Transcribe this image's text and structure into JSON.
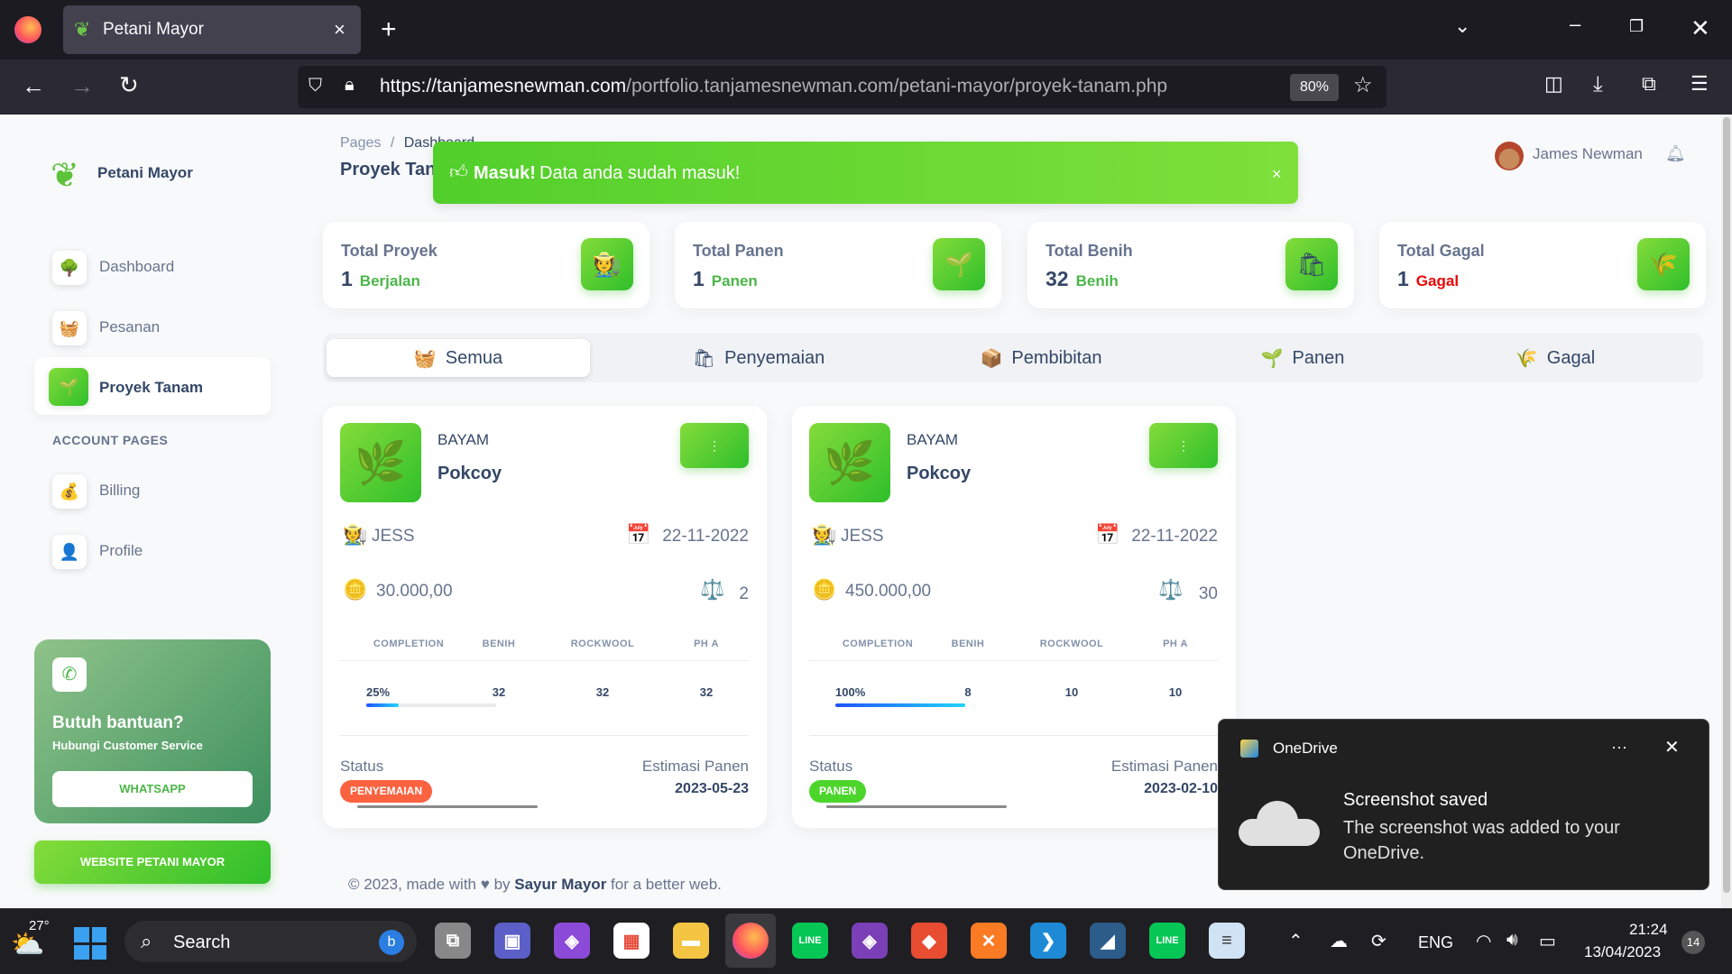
{
  "browser": {
    "tab_title": "Petani Mayor",
    "url_host": "https://tanjamesnewman.com",
    "url_path": "/portfolio.tanjamesnewman.com/petani-mayor/proyek-tanam.php",
    "zoom": "80%"
  },
  "sidebar": {
    "brand": "Petani Mayor",
    "items": [
      {
        "label": "Dashboard",
        "icon": "🌳"
      },
      {
        "label": "Pesanan",
        "icon": "🧺"
      },
      {
        "label": "Proyek Tanam",
        "icon": "🌱"
      }
    ],
    "section_label": "ACCOUNT PAGES",
    "account_items": [
      {
        "label": "Billing",
        "icon": "💰"
      },
      {
        "label": "Profile",
        "icon": "👤"
      }
    ],
    "help": {
      "title": "Butuh bantuan?",
      "subtitle": "Hubungi Customer Service",
      "button": "WHATSAPP"
    },
    "website_button": "WEBSITE PETANI MAYOR"
  },
  "header": {
    "breadcrumb_root": "Pages",
    "breadcrumb_sep": "/",
    "breadcrumb_current": "Dashboard",
    "page_title": "Proyek Tanam",
    "user_name": "James Newman"
  },
  "alert": {
    "strong": "Masuk!",
    "message": "Data anda sudah masuk!",
    "close": "×"
  },
  "stats": [
    {
      "title": "Total Proyek",
      "value": "1",
      "unit": "Berjalan",
      "unit_color": "#4cb648",
      "icon": "🧑‍🌾"
    },
    {
      "title": "Total Panen",
      "value": "1",
      "unit": "Panen",
      "unit_color": "#4cb648",
      "icon": "🌱"
    },
    {
      "title": "Total Benih",
      "value": "32",
      "unit": "Benih",
      "unit_color": "#4cb648",
      "icon": "🛍"
    },
    {
      "title": "Total Gagal",
      "value": "1",
      "unit": "Gagal",
      "unit_color": "#ea0606",
      "icon": "🌾"
    }
  ],
  "filter_tabs": [
    {
      "label": "Semua",
      "icon": "🧺"
    },
    {
      "label": "Penyemaian",
      "icon": "🛍"
    },
    {
      "label": "Pembibitan",
      "icon": "📦"
    },
    {
      "label": "Panen",
      "icon": "🌱"
    },
    {
      "label": "Gagal",
      "icon": "🌾"
    }
  ],
  "table_headers": [
    "COMPLETION",
    "BENIH",
    "ROCKWOOL",
    "PH A"
  ],
  "labels": {
    "status": "Status",
    "estimasi": "Estimasi Panen"
  },
  "projects": [
    {
      "category": "BAYAM",
      "name": "Pokcoy",
      "farmer": "JESS",
      "date": "22-11-2022",
      "price": "30.000,00",
      "quantity": "2",
      "completion": "25%",
      "completion_value": 25,
      "benih": "32",
      "rockwool": "32",
      "ph": "32",
      "status": "PENYEMAIAN",
      "status_color": "#fb6340",
      "estimasi": "2023-05-23"
    },
    {
      "category": "BAYAM",
      "name": "Pokcoy",
      "farmer": "JESS",
      "date": "22-11-2022",
      "price": "450.000,00",
      "quantity": "30",
      "completion": "100%",
      "completion_value": 100,
      "benih": "8",
      "rockwool": "10",
      "ph": "10",
      "status": "PANEN",
      "status_color": "#4cd62b",
      "estimasi": "2023-02-10"
    }
  ],
  "footer": {
    "prefix": "© 2023, made with",
    "by": "by",
    "author": "Sayur Mayor",
    "suffix": "for a better web."
  },
  "toast": {
    "app": "OneDrive",
    "more": "···",
    "title": "Screenshot saved",
    "body": "The screenshot was added to your OneDrive."
  },
  "taskbar": {
    "weather": "27°",
    "search": "Search",
    "lang": "ENG",
    "time": "21:24",
    "date": "13/04/2023",
    "notifications": "14"
  }
}
